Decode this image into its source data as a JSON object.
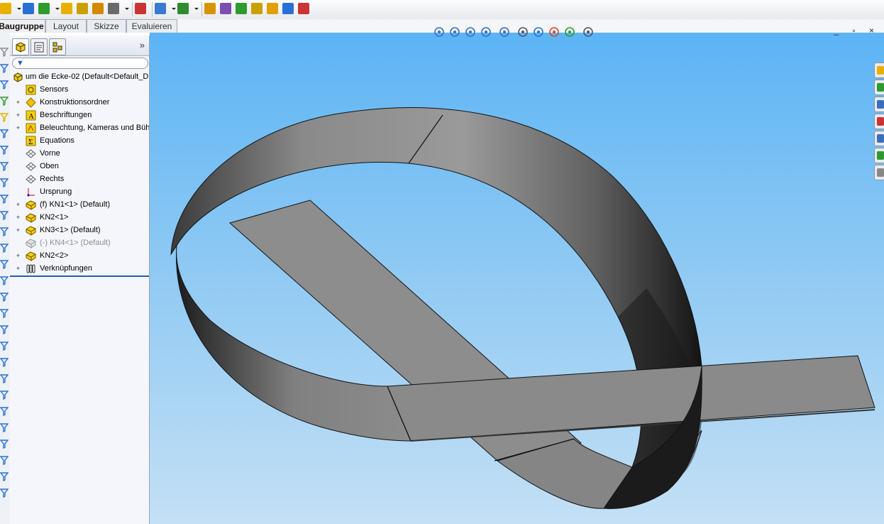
{
  "cm_tabs": [
    "Baugruppe",
    "Layout",
    "Skizze",
    "Evaluieren"
  ],
  "active_tab": "Baugruppe",
  "feature_tree": {
    "root": "um die Ecke-02  (Default<Default_D",
    "items": [
      {
        "label": "Sensors",
        "icon": "sensors-icon",
        "expandable": false,
        "suppressed": false
      },
      {
        "label": "Konstruktionsordner",
        "icon": "design-binder-icon",
        "expandable": true,
        "suppressed": false
      },
      {
        "label": "Beschriftungen",
        "icon": "annotations-icon",
        "expandable": true,
        "suppressed": false
      },
      {
        "label": "Beleuchtung, Kameras und Bühr",
        "icon": "lights-icon",
        "expandable": true,
        "suppressed": false
      },
      {
        "label": "Equations",
        "icon": "equations-icon",
        "expandable": false,
        "suppressed": false
      },
      {
        "label": "Vorne",
        "icon": "plane-icon",
        "expandable": false,
        "suppressed": false
      },
      {
        "label": "Oben",
        "icon": "plane-icon",
        "expandable": false,
        "suppressed": false
      },
      {
        "label": "Rechts",
        "icon": "plane-icon",
        "expandable": false,
        "suppressed": false
      },
      {
        "label": "Ursprung",
        "icon": "origin-icon",
        "expandable": false,
        "suppressed": false
      },
      {
        "label": "(f) KN1<1> (Default)",
        "icon": "part-icon",
        "expandable": true,
        "suppressed": false
      },
      {
        "label": "KN2<1>",
        "icon": "part-icon",
        "expandable": true,
        "suppressed": false
      },
      {
        "label": "KN3<1> (Default)",
        "icon": "part-icon",
        "expandable": true,
        "suppressed": false
      },
      {
        "label": "(-) KN4<1> (Default)",
        "icon": "part-icon",
        "expandable": false,
        "suppressed": true
      },
      {
        "label": "KN2<2>",
        "icon": "part-icon",
        "expandable": true,
        "suppressed": false
      },
      {
        "label": "Verknüpfungen",
        "icon": "mates-icon",
        "expandable": true,
        "suppressed": false
      }
    ]
  },
  "fm_expand_glyph": "»",
  "window_controls": "_ ▫ ×",
  "colors": {
    "viewport_top": "#5cb4f5",
    "viewport_bottom": "#c4e0f5",
    "sheet_metal_light": "#9a9a9a",
    "sheet_metal_dark": "#1a1a1a",
    "tree_accent": "#2a5db0"
  }
}
